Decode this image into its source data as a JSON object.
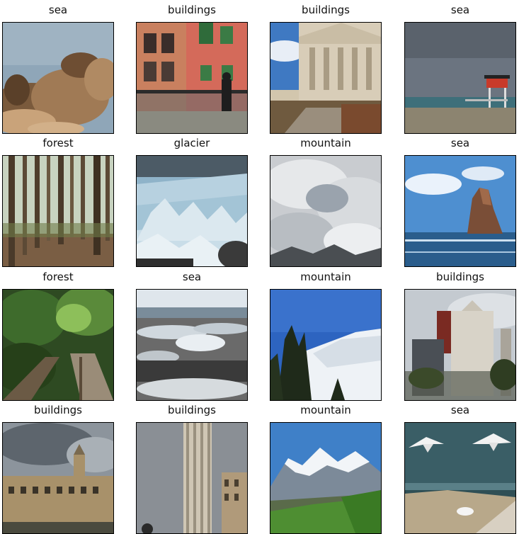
{
  "images": [
    {
      "label": "sea"
    },
    {
      "label": "buildings"
    },
    {
      "label": "buildings"
    },
    {
      "label": "sea"
    },
    {
      "label": "forest"
    },
    {
      "label": "glacier"
    },
    {
      "label": "mountain"
    },
    {
      "label": "sea"
    },
    {
      "label": "forest"
    },
    {
      "label": "sea"
    },
    {
      "label": "mountain"
    },
    {
      "label": "buildings"
    },
    {
      "label": "buildings"
    },
    {
      "label": "buildings"
    },
    {
      "label": "mountain"
    },
    {
      "label": "sea"
    }
  ]
}
